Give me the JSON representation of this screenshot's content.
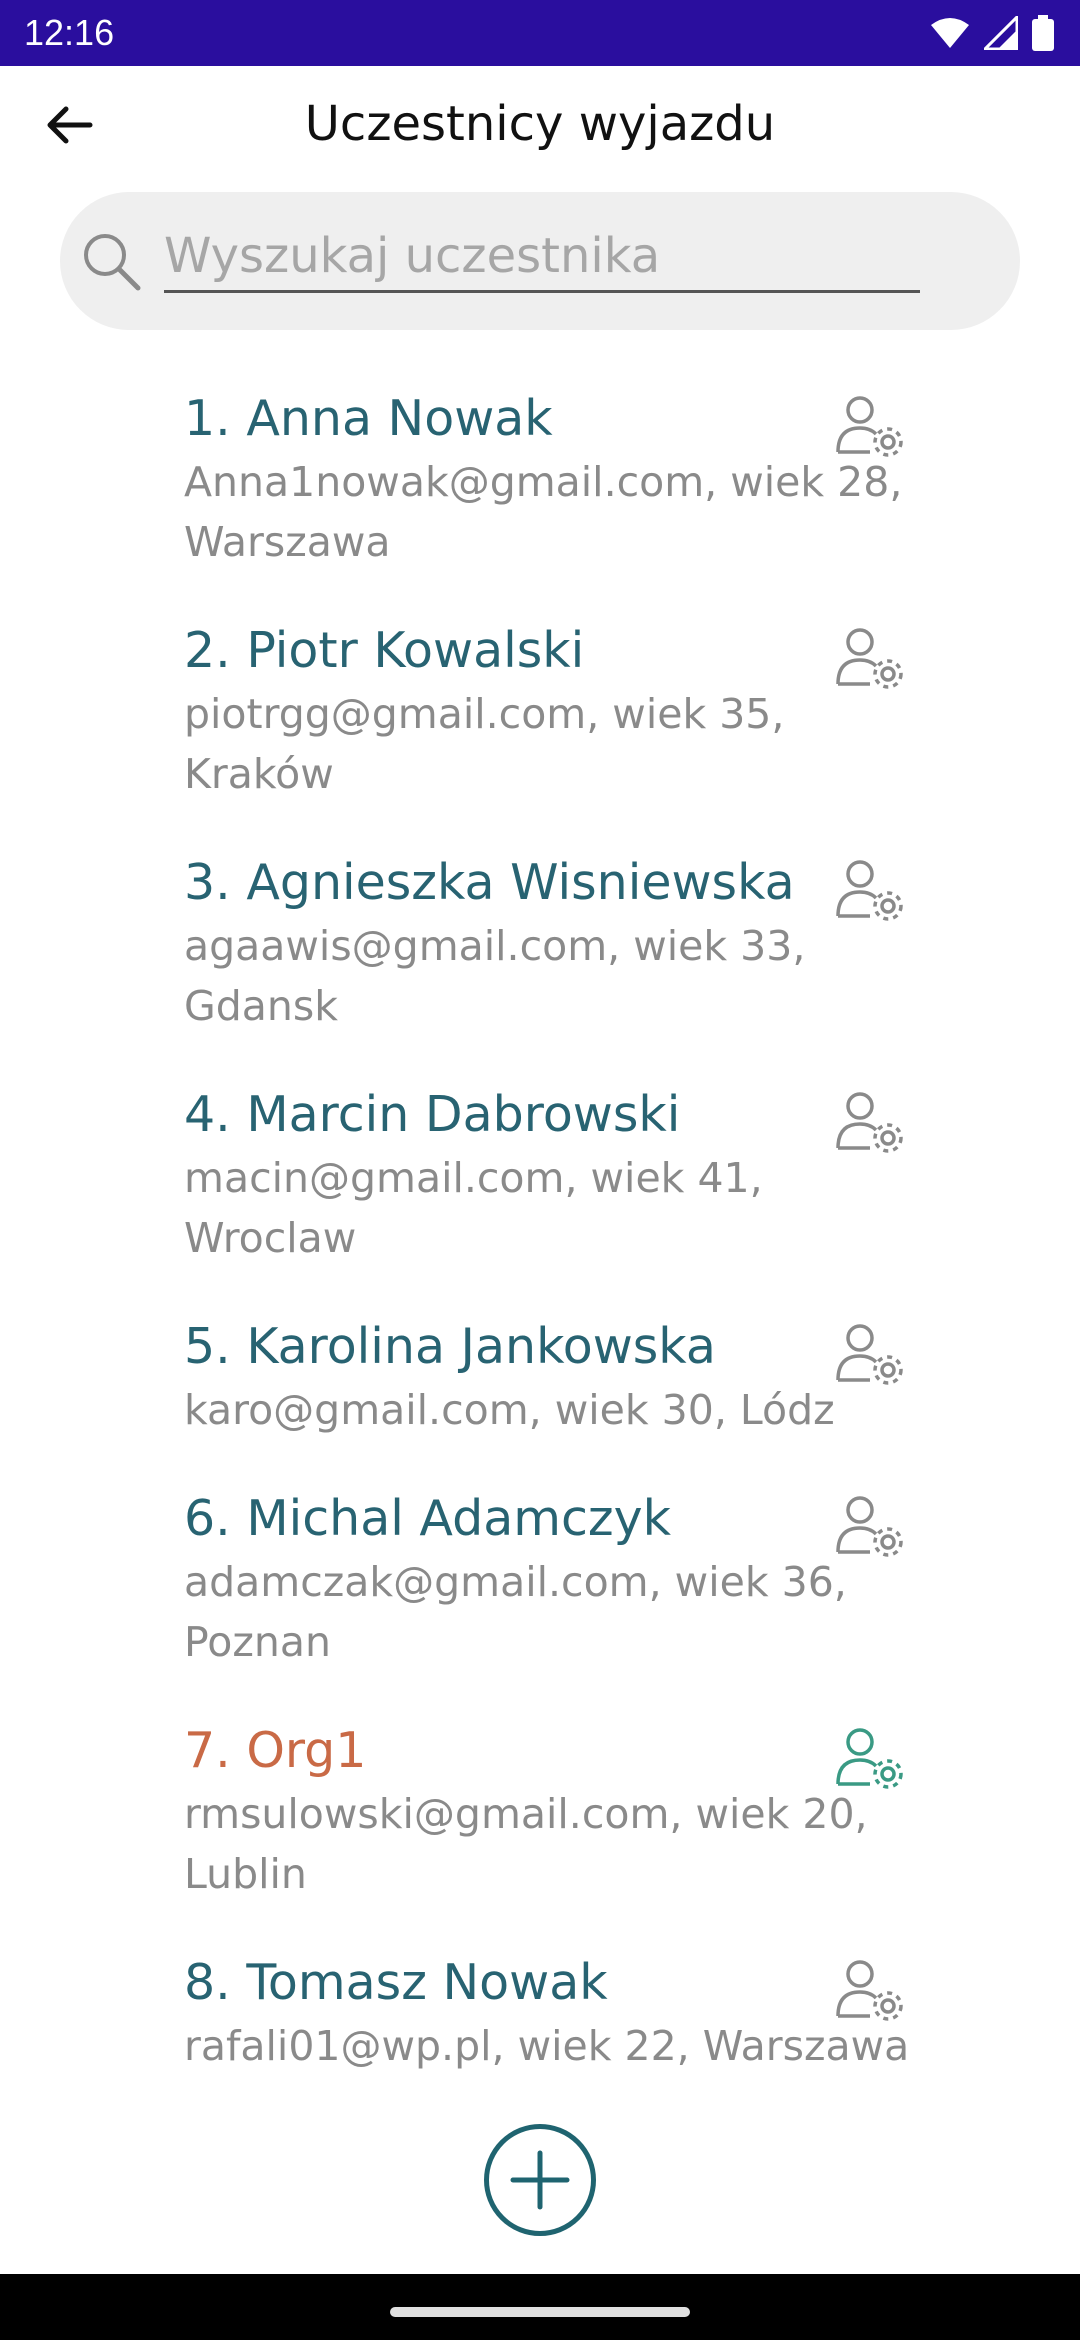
{
  "status_bar": {
    "time": "12:16",
    "icons": [
      "wifi-icon",
      "signal-icon",
      "battery-icon"
    ],
    "background_color": "#2a0e9e"
  },
  "header": {
    "title": "Uczestnicy wyjazdu",
    "back_icon": "arrow-left-icon"
  },
  "search": {
    "placeholder": "Wyszukaj uczestnika",
    "value": "",
    "icon": "search-icon"
  },
  "participants": [
    {
      "name": "1. Anna Nowak",
      "details": "Anna1nowak@gmail.com, wiek 28, Warszawa",
      "organizer": false
    },
    {
      "name": "2. Piotr Kowalski",
      "details": "piotrgg@gmail.com, wiek 35, Kraków",
      "organizer": false
    },
    {
      "name": "3. Agnieszka Wisniewska",
      "details": "agaawis@gmail.com, wiek 33, Gdansk",
      "organizer": false
    },
    {
      "name": "4. Marcin Dabrowski",
      "details": "macin@gmail.com, wiek 41, Wroclaw",
      "organizer": false
    },
    {
      "name": "5. Karolina Jankowska",
      "details": "karo@gmail.com, wiek 30, Lódz",
      "organizer": false
    },
    {
      "name": "6. Michal Adamczyk",
      "details": "adamczak@gmail.com, wiek 36, Poznan",
      "organizer": false
    },
    {
      "name": "7. Org1",
      "details": "rmsulowski@gmail.com, wiek 20, Lublin",
      "organizer": true
    },
    {
      "name": "8. Tomasz Nowak",
      "details": "rafali01@wp.pl, wiek 22, Warszawa",
      "organizer": false
    }
  ],
  "colors": {
    "name_color": "#286372",
    "organizer_name_color": "#c96a46",
    "details_color": "#8a8a8a",
    "manage_icon_color": "#8a8a8a",
    "organizer_icon_color": "#3a9a84",
    "add_button_color": "#1f6470"
  },
  "add_button_icon": "plus-circle-icon"
}
